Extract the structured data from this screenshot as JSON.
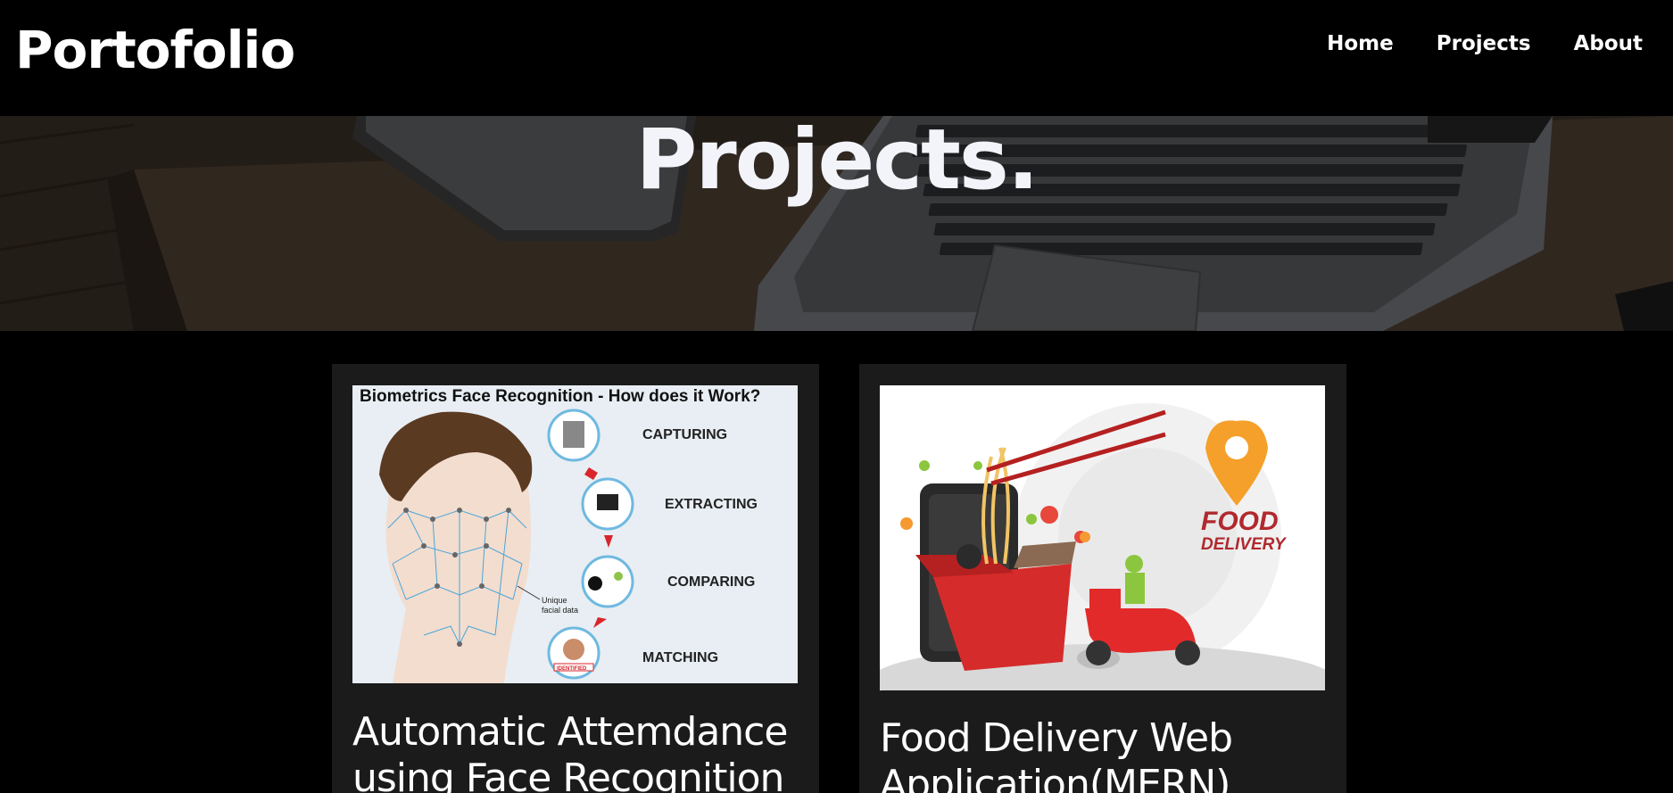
{
  "navbar": {
    "brand": "Portofolio",
    "links": [
      {
        "label": "Home"
      },
      {
        "label": "Projects"
      },
      {
        "label": "About"
      }
    ]
  },
  "hero": {
    "title": "Projects."
  },
  "projects": [
    {
      "title_line1": "Automatic Attemdance",
      "title_line2": "using Face Recognition",
      "image": {
        "heading": "Biometrics Face Recognition - How does it Work?",
        "steps": [
          "CAPTURING",
          "EXTRACTING",
          "COMPARING",
          "MATCHING"
        ],
        "annotation_line1": "Unique",
        "annotation_line2": "facial data",
        "stamp": "IDENTIFIED"
      }
    },
    {
      "title_line1": "Food Delivery Web",
      "title_line2": "Application(MERN)",
      "image": {
        "brand_line1": "FOOD",
        "brand_line2": "DELIVERY"
      }
    }
  ],
  "colors": {
    "background": "#000000",
    "card": "#1b1b1b",
    "hero_title": "#f2f4fa",
    "food_brand": "#b0292e",
    "pin": "#f5a02a",
    "step_arrow": "#d8262c"
  }
}
